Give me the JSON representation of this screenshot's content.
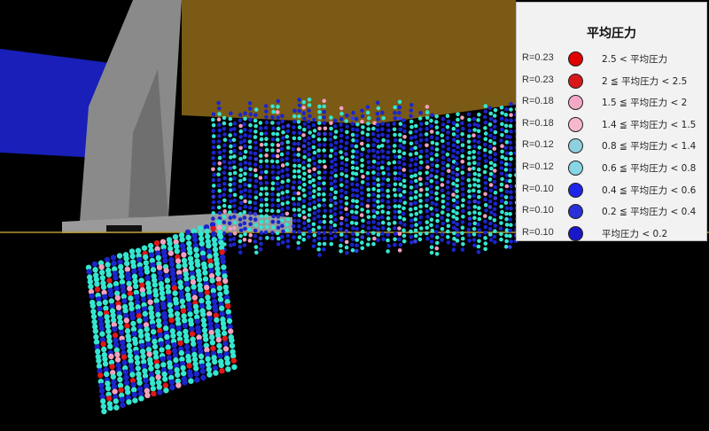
{
  "legend": {
    "title": "平均圧力",
    "items": [
      {
        "r": "R=0.23",
        "label": "2.5 < 平均圧力",
        "color": "#e00000"
      },
      {
        "r": "R=0.23",
        "label": "2 ≦ 平均圧力 < 2.5",
        "color": "#d81818"
      },
      {
        "r": "R=0.18",
        "label": "1.5 ≦ 平均圧力 < 2",
        "color": "#f3a9c6"
      },
      {
        "r": "R=0.18",
        "label": "1.4 ≦ 平均圧力 < 1.5",
        "color": "#f6b8cf"
      },
      {
        "r": "R=0.12",
        "label": "0.8 ≦ 平均圧力 < 1.4",
        "color": "#8fd0df"
      },
      {
        "r": "R=0.12",
        "label": "0.6 ≦ 平均圧力 < 0.8",
        "color": "#86d6e4"
      },
      {
        "r": "R=0.10",
        "label": "0.4 ≦ 平均圧力 < 0.6",
        "color": "#1f25e6"
      },
      {
        "r": "R=0.10",
        "label": "0.2 ≦ 平均圧力 < 0.4",
        "color": "#2a2fd8"
      },
      {
        "r": "R=0.10",
        "label": "平均圧力 < 0.2",
        "color": "#1818c8"
      }
    ]
  },
  "colors": {
    "background": "#000000",
    "brown_plane": "#7a5a14",
    "blue_plane": "#1b22c8",
    "gray_structure": "#8a8a8a",
    "particle_cyan": "#35e6d0",
    "particle_blue": "#1c25cc",
    "particle_red": "#e01818",
    "particle_pink": "#f3a0c0"
  }
}
